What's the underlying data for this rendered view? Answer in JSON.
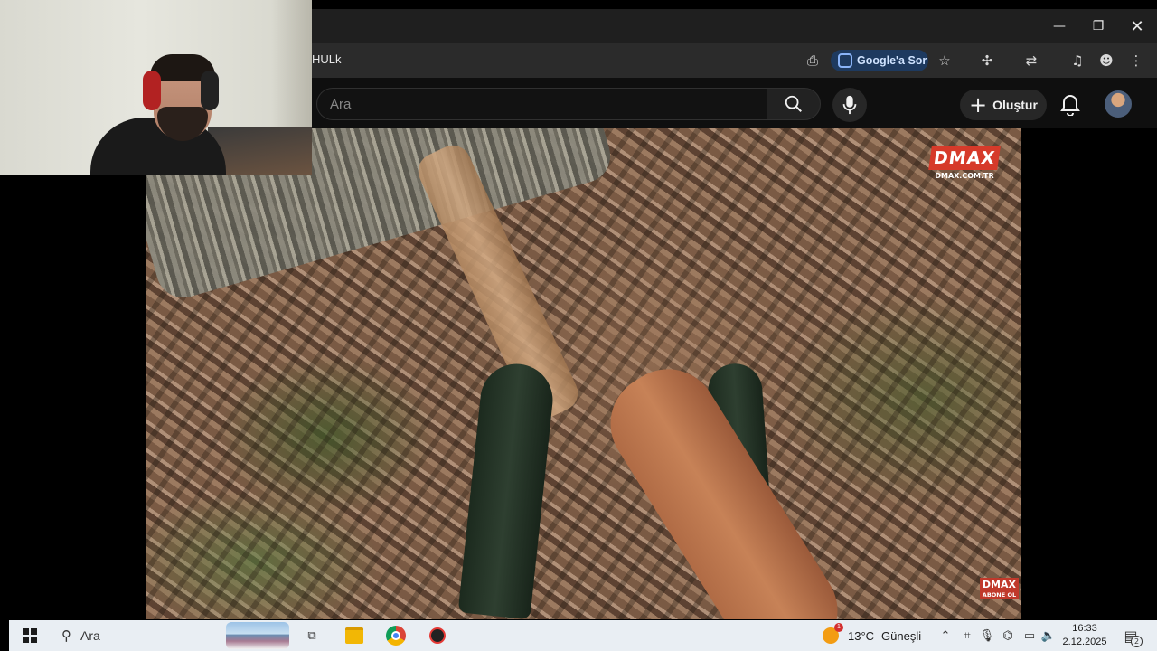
{
  "browser": {
    "tab_title": "HULk",
    "google_ask_label": "Google'a Sor",
    "icons": [
      "minimize-icon",
      "restore-icon",
      "close-icon",
      "cast-icon",
      "lens-icon",
      "star-icon",
      "extensions-icon",
      "translate-icon",
      "media-icon",
      "profile-icon",
      "menu-icon"
    ]
  },
  "youtube": {
    "search_placeholder": "Ara",
    "create_label": "Oluştur",
    "icons": [
      "search-icon",
      "mic-icon",
      "plus-icon",
      "bell-icon"
    ]
  },
  "video": {
    "watermark_logo": "DMAX",
    "watermark_url": "DMAX.COM.TR",
    "subscribe_logo": "DMAX",
    "subscribe_text": "ABONE OL"
  },
  "taskbar": {
    "search_label": "Ara",
    "weather_temp": "13°C",
    "weather_text": "Güneşli",
    "weather_badge": "1",
    "time": "16:33",
    "date": "2.12.2025",
    "notification_count": "2",
    "icons": [
      "windows-start-icon",
      "search-icon",
      "task-view-icon",
      "file-explorer-icon",
      "chrome-icon",
      "app-icon",
      "chevron-up-icon",
      "tray-icon",
      "mic-icon",
      "network-icon",
      "volume-icon",
      "notification-icon"
    ]
  }
}
